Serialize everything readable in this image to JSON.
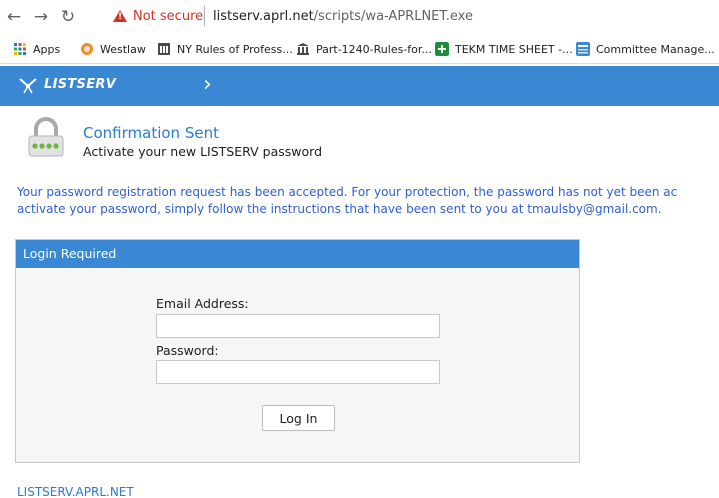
{
  "browser": {
    "not_secure": "Not secure",
    "url_host": "listserv.aprl.net",
    "url_path": "/scripts/wa-APRLNET.exe",
    "bookmarks": [
      {
        "label": "Apps",
        "icon": "apps-grid-icon",
        "color": "#1a73e8"
      },
      {
        "label": "Westlaw",
        "icon": "westlaw-icon",
        "color": "#f28b2b"
      },
      {
        "label": "NY Rules of Profess...",
        "icon": "building-icon",
        "color": "#4a4a4a"
      },
      {
        "label": "Part-1240-Rules-for...",
        "icon": "courthouse-icon",
        "color": "#4a4a4a"
      },
      {
        "label": "TEKM TIME SHEET -...",
        "icon": "sheets-plus-icon",
        "color": "#1e8e3e"
      },
      {
        "label": "Committee Manage...",
        "icon": "listserv-icon",
        "color": "#3a87d4"
      }
    ]
  },
  "banner": {
    "brand": "LISTSERV",
    "chevron": "›",
    "color": "#3a87d4"
  },
  "confirmation": {
    "title": "Confirmation Sent",
    "subtitle": "Activate your new LISTSERV password",
    "message_line1": "Your password registration request has been accepted. For your protection, the password has not yet been ac",
    "message_line2": "activate your password, simply follow the instructions that have been sent to you at tmaulsby@gmail.com."
  },
  "login": {
    "header": "Login Required",
    "email_label": "Email Address:",
    "email_value": "",
    "password_label": "Password:",
    "password_value": "",
    "button_label": "Log In"
  },
  "footer": {
    "link": "LISTSERV.APRL.NET"
  }
}
